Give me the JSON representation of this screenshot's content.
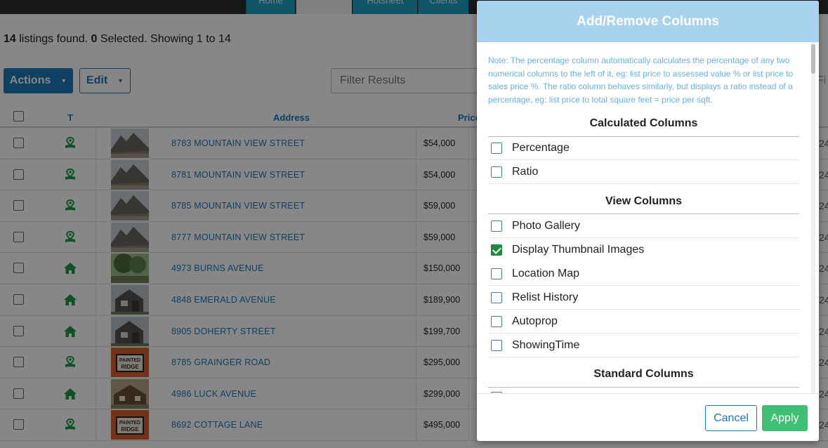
{
  "nav": {
    "tabs": [
      {
        "label": "Home"
      },
      {
        "label": ""
      },
      {
        "label": "Hotsheet"
      },
      {
        "label": "Clients"
      }
    ]
  },
  "summary": {
    "count": "14",
    "count_suffix": " listings found. ",
    "selected": "0",
    "selected_suffix": " Selected. Showing 1 to 14"
  },
  "toolbar": {
    "actions_label": "Actions",
    "edit_label": "Edit",
    "filter_placeholder": "Filter Results",
    "right_filter_text": "Fi"
  },
  "table": {
    "headers": {
      "type": "T",
      "address": "Address",
      "price": "Price"
    },
    "rows": [
      {
        "type": "land",
        "address": "8783 MOUNTAIN VIEW STREET",
        "price": "$54,000",
        "right": "24",
        "thumb": "mountain"
      },
      {
        "type": "land",
        "address": "8781 MOUNTAIN VIEW STREET",
        "price": "$54,000",
        "right": "24",
        "thumb": "mountain"
      },
      {
        "type": "land",
        "address": "8785 MOUNTAIN VIEW STREET",
        "price": "$59,000",
        "right": "24",
        "thumb": "mountain"
      },
      {
        "type": "land",
        "address": "8777 MOUNTAIN VIEW STREET",
        "price": "$59,000",
        "right": "24",
        "thumb": "mountain"
      },
      {
        "type": "house",
        "address": "4973 BURNS AVENUE",
        "price": "$150,000",
        "right": "24",
        "thumb": "tree"
      },
      {
        "type": "house",
        "address": "4848 EMERALD AVENUE",
        "price": "$189,900",
        "right": "24",
        "thumb": "house"
      },
      {
        "type": "house",
        "address": "8905 DOHERTY STREET",
        "price": "$199,700",
        "right": "24",
        "thumb": "house"
      },
      {
        "type": "land",
        "address": "8785 GRAINGER ROAD",
        "price": "$295,000",
        "right": "24",
        "thumb": "sign"
      },
      {
        "type": "house",
        "address": "4986 LUCK AVENUE",
        "price": "$299,000",
        "right": "24",
        "thumb": "cabin"
      },
      {
        "type": "land",
        "address": "8692 COTTAGE LANE",
        "price": "$495,000",
        "right": "24",
        "thumb": "sign"
      }
    ],
    "sign_text": [
      "PAINTED",
      "RIDGE"
    ]
  },
  "modal": {
    "title": "Add/Remove Columns",
    "note": "Note: The percentage column automatically calculates the percentage of any two numerical columns to the left of it, eg: list price to assessed value % or list price to sales price %. The ratio column behaves similarly, but displays a ratio instead of a percentage, eg: list price to total square feet = price per sqft.",
    "sections": {
      "calculated": {
        "title": "Calculated Columns",
        "options": [
          {
            "label": "Percentage",
            "checked": false
          },
          {
            "label": "Ratio",
            "checked": false
          }
        ]
      },
      "view": {
        "title": "View Columns",
        "options": [
          {
            "label": "Photo Gallery",
            "checked": false
          },
          {
            "label": "Display Thumbnail Images",
            "checked": true
          },
          {
            "label": "Location Map",
            "checked": false
          },
          {
            "label": "Relist History",
            "checked": false
          },
          {
            "label": "Autoprop",
            "checked": false
          },
          {
            "label": "ShowingTime",
            "checked": false
          }
        ]
      },
      "standard": {
        "title": "Standard Columns"
      }
    },
    "cancel_label": "Cancel",
    "apply_label": "Apply"
  },
  "colors": {
    "accent": "#1a7ab8",
    "header": "#a7d3ee",
    "apply": "#3fbf74",
    "highlight": "#f8f01a",
    "check": "#1e8a3c",
    "type_icon": "#1e9a44"
  }
}
